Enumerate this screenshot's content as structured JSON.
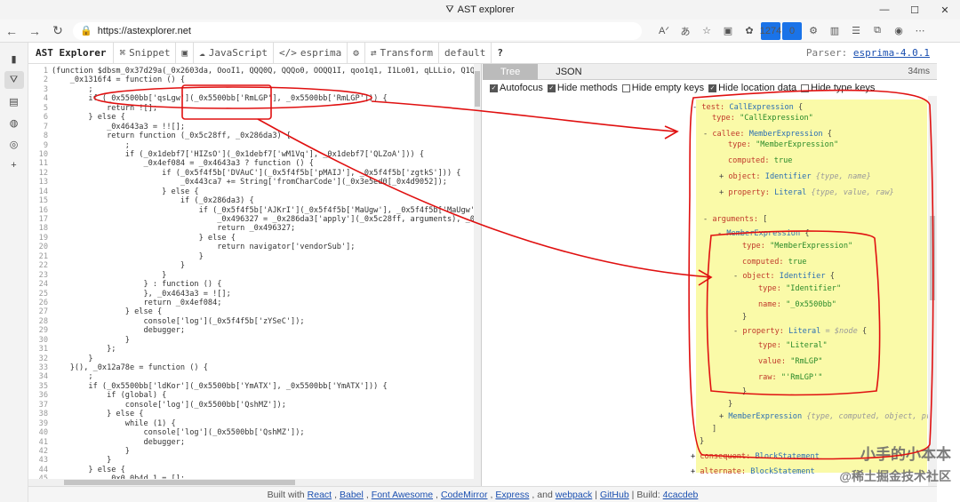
{
  "browser": {
    "tab_title": "AST explorer",
    "url": "https://astexplorer.net",
    "ext_badge_1": "1274",
    "ext_badge_2": "0"
  },
  "toolbar": {
    "brand": "AST Explorer",
    "snippet": "Snippet",
    "language": "JavaScript",
    "parser_name": "esprima",
    "transform": "Transform",
    "transform_value": "default",
    "help": "?",
    "parser_label": "Parser:",
    "parser_link": "esprima-4.0.1"
  },
  "editor": {
    "line_numbers": [
      "1",
      "2",
      "3",
      "4",
      "5",
      "6",
      "7",
      "8",
      "9",
      "10",
      "11",
      "12",
      "13",
      "14",
      "15",
      "16",
      "17",
      "18",
      "19",
      "20",
      "21",
      "22",
      "23",
      "24",
      "25",
      "26",
      "27",
      "28",
      "29",
      "30",
      "31",
      "32",
      "33",
      "34",
      "35",
      "36",
      "37",
      "38",
      "39",
      "40",
      "41",
      "42",
      "43",
      "44",
      "45"
    ],
    "lines": [
      "(function $dbsm_0x37d29a(_0x2603da, OooI1, QQQ0Q, QQQo0, OOQQ1I, qoo1q1, I1Lo01, qLLLio, Q1Qq",
      "    _0x1316f4 = function () {",
      "        ;",
      "        if (_0x5500bb['qsLgw'](_0x5500bb['RmLGP'], _0x5500bb['RmLGP'])) {",
      "            return ![];",
      "        } else {",
      "            _0x4643a3 = !![];",
      "            return function (_0x5c28ff, _0x286da3) {",
      "                ;",
      "                if (_0x1debf7['HIZsO'](_0x1debf7['wM1Vq'], _0x1debf7['QLZoA'])) {",
      "                    _0x4ef084 = _0x4643a3 ? function () {",
      "                        if (_0x5f4f5b['DVAuC'](_0x5f4f5b['pMAIJ'], _0x5f4f5b['zgtkS'])) {",
      "                            _0x443ca7 += String['fromCharCode'](_0x3e5ed0[_0x4d9052]);",
      "                        } else {",
      "                            if (_0x286da3) {",
      "                                if (_0x5f4f5b['AJKrI'](_0x5f4f5b['MaUgw'], _0x5f4f5b['MaUgw'])) {",
      "                                    _0x496327 = _0x286da3['apply'](_0x5c28ff, arguments), _0x286",
      "                                    return _0x496327;",
      "                                } else {",
      "                                    return navigator['vendorSub'];",
      "                                }",
      "                            }",
      "                        }",
      "                    } : function () {",
      "                    }, _0x4643a3 = ![];",
      "                    return _0x4ef084;",
      "                } else {",
      "                    console['log'](_0x5f4f5b['zYSeC']);",
      "                    debugger;",
      "                }",
      "            };",
      "        }",
      "    }(), _0x12a78e = function () {",
      "        ;",
      "        if (_0x5500bb['ldKor'](_0x5500bb['YmATX'], _0x5500bb['YmATX'])) {",
      "            if (global) {",
      "                console['log'](_0x5500bb['QshMZ']);",
      "            } else {",
      "                while (1) {",
      "                    console['log'](_0x5500bb['QshMZ']);",
      "                    debugger;",
      "                }",
      "            }",
      "        } else {",
      "            _0x0_0b4d_1 = [];"
    ]
  },
  "output": {
    "tabs": [
      "Tree",
      "JSON"
    ],
    "timing": "34ms",
    "options": [
      {
        "label": "Autofocus",
        "checked": true
      },
      {
        "label": "Hide methods",
        "checked": true
      },
      {
        "label": "Hide empty keys",
        "checked": false
      },
      {
        "label": "Hide location data",
        "checked": true
      },
      {
        "label": "Hide type keys",
        "checked": false
      }
    ],
    "tree": {
      "test_key": "test:",
      "test_type": "CallExpression",
      "test_type_key": "type:",
      "test_type_val": "\"CallExpression\"",
      "callee_key": "callee:",
      "callee_type": "MemberExpression",
      "callee_typekey": "type:",
      "callee_typeval": "\"MemberExpression\"",
      "callee_computed_key": "computed:",
      "callee_computed_val": "true",
      "callee_object_key": "object:",
      "callee_object_type": "Identifier",
      "callee_object_meta": "{type, name}",
      "callee_property_key": "property:",
      "callee_property_type": "Literal",
      "callee_property_meta": "{type, value, raw}",
      "arguments_key": "arguments:",
      "arguments_bracket": "[",
      "arg0_type": "MemberExpression",
      "arg0_typekey": "type:",
      "arg0_typeval": "\"MemberExpression\"",
      "arg0_computed_key": "computed:",
      "arg0_computed_val": "true",
      "arg0_object_key": "object:",
      "arg0_object_type": "Identifier",
      "arg0_object_typekey": "type:",
      "arg0_object_typeval": "\"Identifier\"",
      "arg0_object_namekey": "name:",
      "arg0_object_nameval": "\"_0x5500bb\"",
      "arg0_property_key": "property:",
      "arg0_property_type": "Literal",
      "arg0_property_node": "= $node",
      "arg0_property_typekey": "type:",
      "arg0_property_typeval": "\"Literal\"",
      "arg0_property_valuekey": "value:",
      "arg0_property_valueval": "\"RmLGP\"",
      "arg0_property_rawkey": "raw:",
      "arg0_property_rawval": "\"'RmLGP'\"",
      "arg1_type": "MemberExpression",
      "arg1_meta": "{type, computed, object, proper",
      "consequent_key": "consequent:",
      "consequent_type": "BlockStatement",
      "alternate_key": "alternate:",
      "alternate_type": "BlockStatement"
    }
  },
  "footer": {
    "built_with": "Built with",
    "react": "React",
    "babel": "Babel",
    "font_awesome": "Font Awesome",
    "codemirror": "CodeMirror",
    "express": "Express",
    "and": "and",
    "webpack": "webpack",
    "github": "GitHub",
    "build_label": "Build:",
    "build_hash": "4cacdeb"
  },
  "watermark": {
    "line1": "小手的小本本",
    "line2": "@稀土掘金技术社区"
  },
  "colors": {
    "annotation": "#e01010",
    "tree_highlight": "#fafaa8",
    "code_highlight": "#fff09a"
  }
}
